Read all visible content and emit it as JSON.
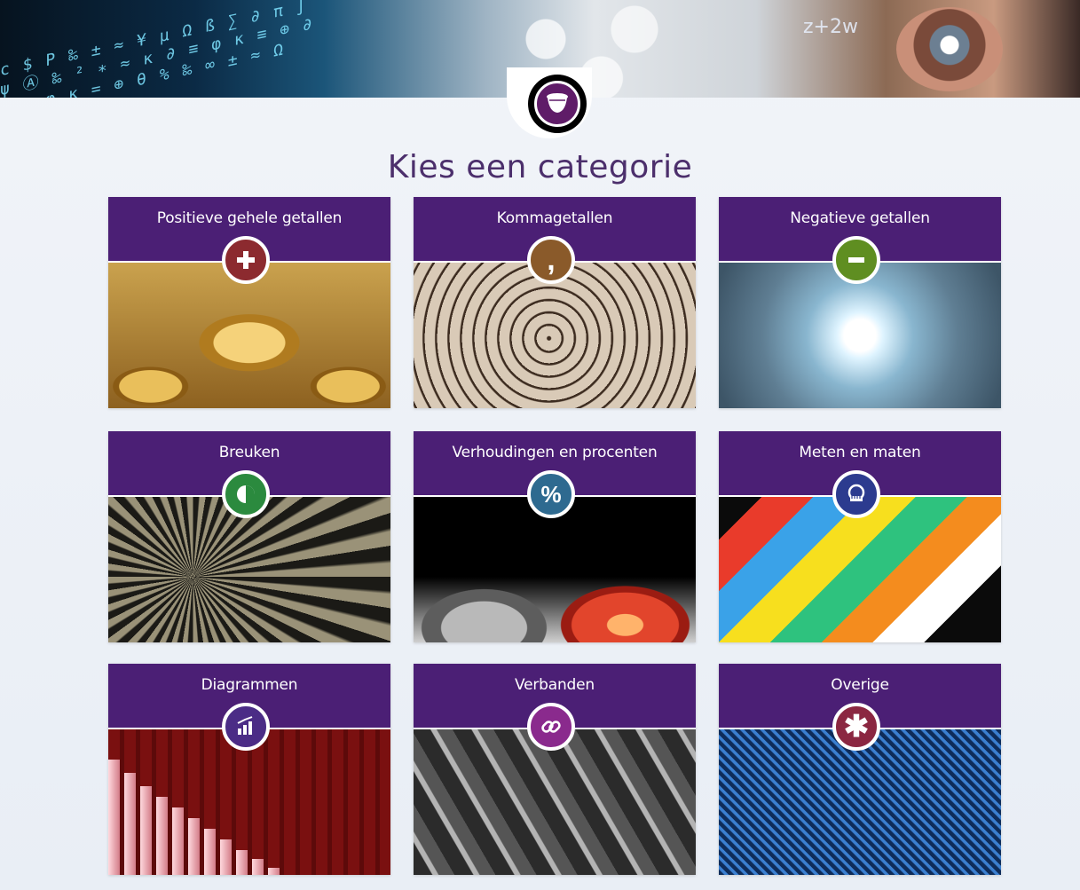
{
  "page": {
    "title": "Kies een categorie",
    "banner_formula": "z+2w"
  },
  "colors": {
    "header_purple": "#4b1f75",
    "title_purple": "#4c2f6c"
  },
  "categories": [
    {
      "label": "Positieve gehele getallen",
      "icon": "plus-icon",
      "badge_color": "#8c2a2f"
    },
    {
      "label": "Kommagetallen",
      "icon": "comma-icon",
      "badge_color": "#8a5a2a"
    },
    {
      "label": "Negatieve getallen",
      "icon": "minus-icon",
      "badge_color": "#5f8e21"
    },
    {
      "label": "Breuken",
      "icon": "fraction-pie-icon",
      "badge_color": "#2b8a3e"
    },
    {
      "label": "Verhoudingen en procenten",
      "icon": "percent-icon",
      "badge_color": "#2e6a90"
    },
    {
      "label": "Meten en maten",
      "icon": "measuring-tape-icon",
      "badge_color": "#2c3b8f"
    },
    {
      "label": "Diagrammen",
      "icon": "bar-chart-icon",
      "badge_color": "#4b2c86"
    },
    {
      "label": "Verbanden",
      "icon": "link-icon",
      "badge_color": "#8a2a8d"
    },
    {
      "label": "Overige",
      "icon": "asterisk-icon",
      "badge_color": "#8b2741"
    }
  ]
}
